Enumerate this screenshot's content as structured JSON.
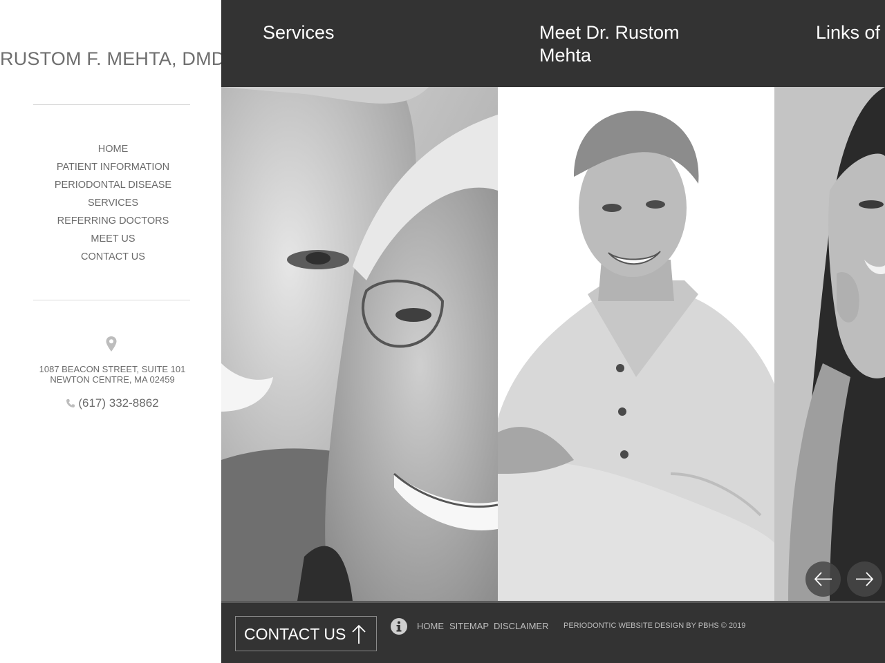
{
  "sidebar": {
    "logo": "RUSTOM F. MEHTA, DMD",
    "nav": [
      "HOME",
      "PATIENT INFORMATION",
      "PERIODONTAL DISEASE",
      "SERVICES",
      "REFERRING DOCTORS",
      "MEET US",
      "CONTACT US"
    ],
    "address_line1": "1087 BEACON STREET, SUITE 101",
    "address_line2": "NEWTON CENTRE, MA 02459",
    "phone": "(617) 332-8862",
    "icons": [
      "map-pin-icon",
      "phone-icon"
    ]
  },
  "slider": {
    "columns": [
      {
        "title": "Services"
      },
      {
        "title": "Meet Dr. Rustom Mehta"
      },
      {
        "title": "Links of"
      }
    ],
    "controls": {
      "prev_icon": "arrow-left-icon",
      "next_icon": "arrow-right-icon"
    }
  },
  "footer": {
    "contact_label": "CONTACT US",
    "links": [
      "HOME",
      "SITEMAP",
      "DISCLAIMER"
    ],
    "credit": "PERIODONTIC WEBSITE DESIGN BY PBHS © 2019",
    "icons": [
      "arrow-up-icon",
      "info-icon"
    ]
  },
  "colors": {
    "dark_bar": "#333333",
    "sidebar_bg": "#ffffff",
    "text_gray": "#6b6b6b",
    "footer_text": "#bdbdbd"
  }
}
